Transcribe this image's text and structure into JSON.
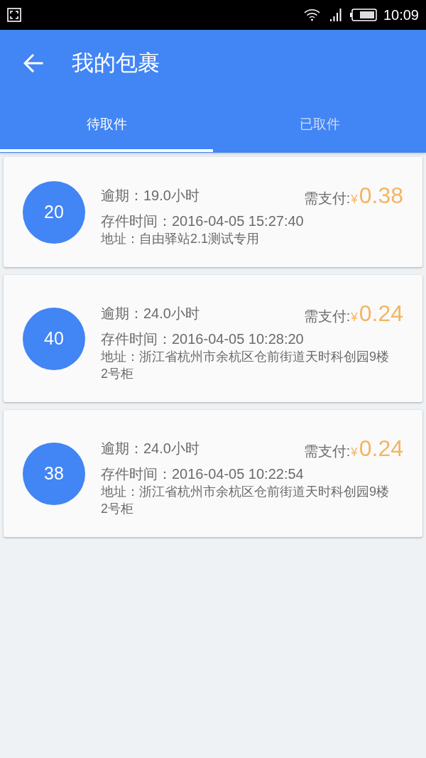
{
  "status_bar": {
    "time": "10:09"
  },
  "header": {
    "title": "我的包裹"
  },
  "tabs": [
    {
      "label": "待取件",
      "selected": true
    },
    {
      "label": "已取件",
      "selected": false
    }
  ],
  "parcels": [
    {
      "number": "20",
      "overdue": "逾期：19.0小时",
      "pay_label": "需支付:",
      "currency": "¥",
      "amount": "0.38",
      "stored": "存件时间：2016-04-05 15:27:40",
      "address": "地址：自由驿站2.1测试专用"
    },
    {
      "number": "40",
      "overdue": "逾期：24.0小时",
      "pay_label": "需支付:",
      "currency": "¥",
      "amount": "0.24",
      "stored": "存件时间：2016-04-05 10:28:20",
      "address": "地址：浙江省杭州市余杭区仓前街道天时科创园9楼2号柜"
    },
    {
      "number": "38",
      "overdue": "逾期：24.0小时",
      "pay_label": "需支付:",
      "currency": "¥",
      "amount": "0.24",
      "stored": "存件时间：2016-04-05 10:22:54",
      "address": "地址：浙江省杭州市余杭区仓前街道天时科创园9楼2号柜"
    }
  ]
}
